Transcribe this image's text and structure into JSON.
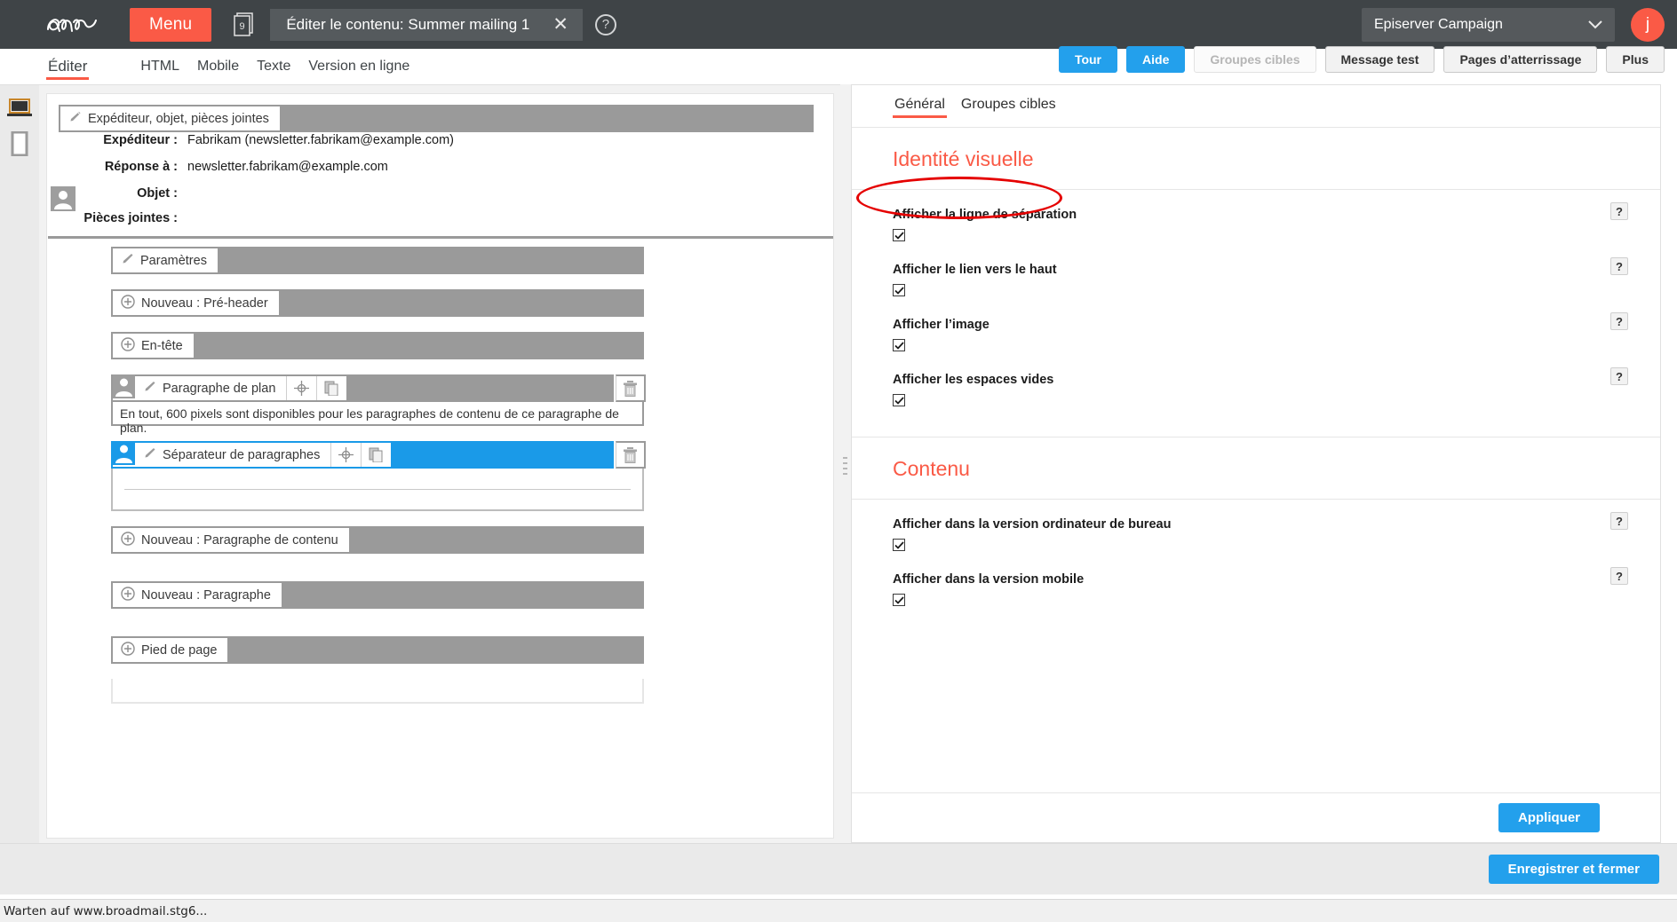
{
  "topbar": {
    "logo": "epi-logo",
    "menu_label": "Menu",
    "docs_badge": "9",
    "document_title": "Éditer le contenu: Summer mailing 1",
    "close_glyph": "✕",
    "help_glyph": "?",
    "client_name": "Episerver Campaign",
    "chevron_glyph": "⌄",
    "avatar_initial": "j"
  },
  "view_tabs": [
    {
      "label": "Éditer",
      "active": true
    },
    {
      "label": "HTML",
      "active": false
    },
    {
      "label": "Mobile",
      "active": false
    },
    {
      "label": "Texte",
      "active": false
    },
    {
      "label": "Version en ligne",
      "active": false
    }
  ],
  "toolbar": [
    {
      "label": "Tour",
      "style": "primary"
    },
    {
      "label": "Aide",
      "style": "primary"
    },
    {
      "label": "Groupes cibles",
      "style": "disabled"
    },
    {
      "label": "Message test",
      "style": "default"
    },
    {
      "label": "Pages d’atterrissage",
      "style": "default"
    },
    {
      "label": "Plus",
      "style": "default"
    }
  ],
  "rail": {
    "desktop_icon": "desktop-preview-icon",
    "mobile_icon": "mobile-preview-icon"
  },
  "editor": {
    "sender_bar_label": "Expéditeur, objet, pièces jointes",
    "fields": [
      {
        "label": "Expéditeur :",
        "value": "Fabrikam (newsletter.fabrikam@example.com)"
      },
      {
        "label": "Réponse à :",
        "value": "newsletter.fabrikam@example.com"
      },
      {
        "label": "Objet :",
        "value": ""
      },
      {
        "label": "Pièces jointes :",
        "value": ""
      }
    ],
    "blocks": [
      {
        "type": "settings",
        "label": "Paramètres",
        "icon": "brush-icon"
      },
      {
        "type": "add",
        "label": "Nouveau : Pré-header",
        "icon": "plus-circle-icon"
      },
      {
        "type": "add",
        "label": "En-tête",
        "icon": "plus-circle-icon"
      },
      {
        "type": "node",
        "label": "Paragraphe de plan",
        "icon": "brush-icon",
        "selected": false,
        "note": "En tout, 600 pixels sont disponibles pour les paragraphes de contenu de ce paragraphe de plan."
      },
      {
        "type": "node",
        "label": "Séparateur de paragraphes",
        "icon": "brush-icon",
        "selected": true
      },
      {
        "type": "add",
        "label": "Nouveau : Paragraphe de contenu",
        "icon": "plus-circle-icon"
      },
      {
        "type": "add",
        "label": "Nouveau : Paragraphe",
        "icon": "plus-circle-icon"
      },
      {
        "type": "add",
        "label": "Pied de page",
        "icon": "plus-circle-icon"
      }
    ]
  },
  "panel": {
    "tabs": [
      {
        "label": "Général",
        "active": true
      },
      {
        "label": "Groupes cibles",
        "active": false
      }
    ],
    "sections": [
      {
        "title": "Identité visuelle",
        "options": [
          {
            "label": "Afficher la ligne de séparation",
            "checked": true,
            "help": "?"
          },
          {
            "label": "Afficher le lien vers le haut",
            "checked": true,
            "help": "?"
          },
          {
            "label": "Afficher l’image",
            "checked": true,
            "help": "?"
          },
          {
            "label": "Afficher les espaces vides",
            "checked": true,
            "help": "?"
          }
        ]
      },
      {
        "title": "Contenu",
        "options": [
          {
            "label": "Afficher dans la version ordinateur de bureau",
            "checked": true,
            "help": "?"
          },
          {
            "label": "Afficher dans la version mobile",
            "checked": true,
            "help": "?"
          }
        ]
      }
    ],
    "apply_label": "Appliquer"
  },
  "footer": {
    "save_label": "Enregistrer et fermer"
  },
  "statusbar": {
    "text": "Warten auf www.broadmail.stg6..."
  },
  "colors": {
    "brand_red": "#fa5a46",
    "accent_blue": "#23a0ec",
    "selection_blue": "#1a9ae8",
    "topbar_dark": "#3f4447",
    "annotation_red": "#e50000"
  }
}
